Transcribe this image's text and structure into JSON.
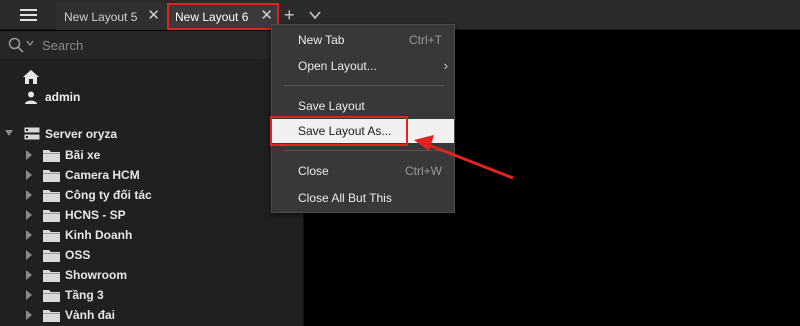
{
  "tabs": [
    {
      "label": "New Layout 5"
    },
    {
      "label": "New Layout 6"
    }
  ],
  "tab_close_glyph": "✕",
  "tab_add_glyph": "+",
  "search": {
    "placeholder": "Search"
  },
  "user": {
    "name": "admin"
  },
  "server": {
    "name": "Server oryza"
  },
  "folders": [
    {
      "label": "Bãi xe"
    },
    {
      "label": "Camera HCM"
    },
    {
      "label": "Công ty đối tác"
    },
    {
      "label": "HCNS - SP"
    },
    {
      "label": "Kinh Doanh"
    },
    {
      "label": "OSS"
    },
    {
      "label": "Showroom"
    },
    {
      "label": "Tầng 3"
    },
    {
      "label": "Vành đai"
    }
  ],
  "context_menu": {
    "new_tab": {
      "label": "New Tab",
      "shortcut": "Ctrl+T"
    },
    "open_layout": {
      "label": "Open Layout...",
      "submenu_glyph": "›"
    },
    "save_layout": {
      "label": "Save Layout"
    },
    "save_layout_as": {
      "label": "Save Layout As..."
    },
    "close": {
      "label": "Close",
      "shortcut": "Ctrl+W"
    },
    "close_all_but_this": {
      "label": "Close All But This"
    }
  },
  "colors": {
    "highlight_red": "#e32222",
    "folder_gray": "#d9d9d9",
    "menu_bg": "#383838",
    "sidebar_bg": "#202020"
  },
  "icons": [
    "hamburger-menu-icon",
    "close-icon",
    "plus-icon",
    "chevron-down-icon",
    "search-icon",
    "home-icon",
    "user-icon",
    "server-icon",
    "folder-icon",
    "caret-right-icon",
    "caret-down-icon"
  ]
}
